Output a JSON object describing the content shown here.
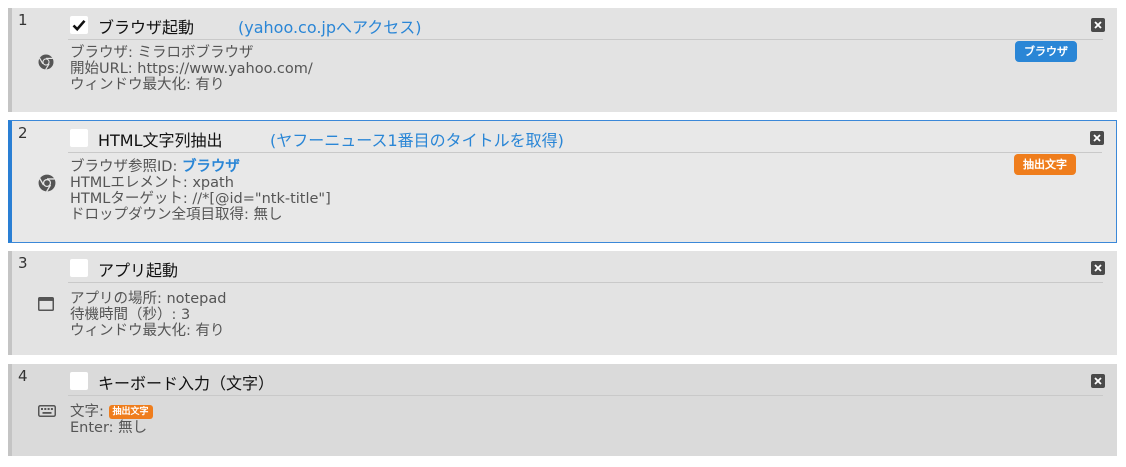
{
  "steps": [
    {
      "number": "1",
      "checked": true,
      "title": "ブラウザ起動",
      "note": "(yahoo.co.jpへアクセス)",
      "icon": "chrome-icon",
      "badge": {
        "label": "ブラウザ",
        "color": "#2a86d6"
      },
      "props": {
        "browser": "ブラウザ: ミラロボブラウザ",
        "start_url": "開始URL: https://www.yahoo.com/",
        "maximize": "ウィンドウ最大化: 有り"
      }
    },
    {
      "number": "2",
      "checked": false,
      "title": "HTML文字列抽出",
      "note": "(ヤフーニュース1番目のタイトルを取得)",
      "icon": "chrome-icon",
      "badge": {
        "label": "抽出文字",
        "color": "#ef7d1c"
      },
      "props": {
        "browser_ref_label": "ブラウザ参照ID: ",
        "browser_ref_value": "ブラウザ",
        "element": "HTMLエレメント: xpath",
        "target": "HTMLターゲット: //*[@id=\"ntk-title\"]",
        "dropdown": "ドロップダウン全項目取得: 無し"
      }
    },
    {
      "number": "3",
      "checked": false,
      "title": "アプリ起動",
      "icon": "window-icon",
      "props": {
        "app_path": "アプリの場所: notepad",
        "wait": "待機時間（秒）: 3",
        "maximize": "ウィンドウ最大化: 有り"
      }
    },
    {
      "number": "4",
      "checked": false,
      "title": "キーボード入力（文字）",
      "icon": "keyboard-icon",
      "props": {
        "text_label": "文字: ",
        "text_badge": "抽出文字",
        "enter": "Enter: 無し"
      }
    }
  ],
  "colors": {
    "accent_blue": "#2a86d6",
    "accent_orange": "#ef7d1c",
    "selected_border": "#2a7fd4"
  }
}
